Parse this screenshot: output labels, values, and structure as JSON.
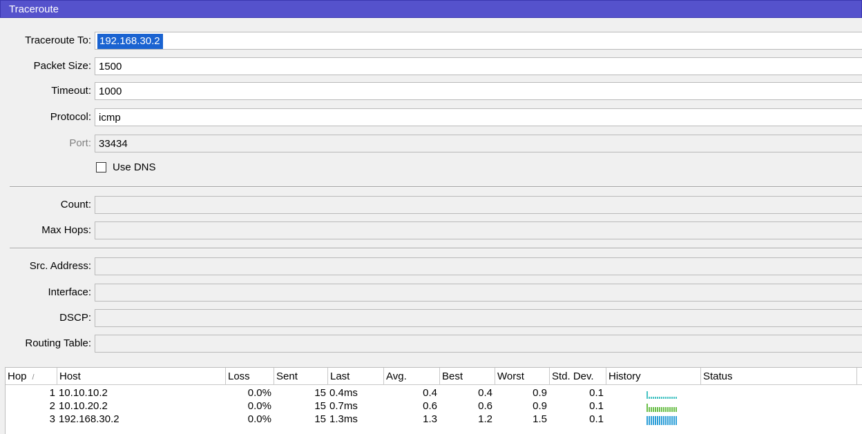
{
  "window": {
    "title": "Traceroute"
  },
  "form": {
    "traceroute_to": {
      "label": "Traceroute To:",
      "value": "192.168.30.2"
    },
    "packet_size": {
      "label": "Packet Size:",
      "value": "1500"
    },
    "timeout": {
      "label": "Timeout:",
      "value": "1000"
    },
    "protocol": {
      "label": "Protocol:",
      "value": "icmp"
    },
    "port": {
      "label": "Port:",
      "value": "33434"
    },
    "use_dns": {
      "label": "Use DNS",
      "checked": false
    },
    "count": {
      "label": "Count:",
      "value": ""
    },
    "max_hops": {
      "label": "Max Hops:",
      "value": ""
    },
    "src_address": {
      "label": "Src. Address:",
      "value": ""
    },
    "interface": {
      "label": "Interface:",
      "value": ""
    },
    "dscp": {
      "label": "DSCP:",
      "value": ""
    },
    "routing_table": {
      "label": "Routing Table:",
      "value": ""
    }
  },
  "table": {
    "columns": [
      "Hop",
      "Host",
      "Loss",
      "Sent",
      "Last",
      "Avg.",
      "Best",
      "Worst",
      "Std. Dev.",
      "History",
      "Status"
    ],
    "sort_indicator": "/",
    "rows": [
      {
        "hop": "1",
        "host": "10.10.10.2",
        "loss": "0.0%",
        "sent": "15",
        "last": "0.4ms",
        "avg": "0.4",
        "best": "0.4",
        "worst": "0.9",
        "std_dev": "0.1",
        "status": "",
        "history_color": "#46c3c3",
        "history_fill": [
          0.85,
          0.2,
          0.2,
          0.2,
          0.2,
          0.2,
          0.2,
          0.2,
          0.2,
          0.2,
          0.2,
          0.2,
          0.2,
          0.2,
          0.2
        ]
      },
      {
        "hop": "2",
        "host": "10.10.20.2",
        "loss": "0.0%",
        "sent": "15",
        "last": "0.7ms",
        "avg": "0.6",
        "best": "0.6",
        "worst": "0.9",
        "std_dev": "0.1",
        "status": "",
        "history_color": "#6cbf4a",
        "history_fill": [
          0.9,
          0.55,
          0.55,
          0.55,
          0.55,
          0.55,
          0.55,
          0.55,
          0.55,
          0.55,
          0.55,
          0.55,
          0.55,
          0.55,
          0.55
        ]
      },
      {
        "hop": "3",
        "host": "192.168.30.2",
        "loss": "0.0%",
        "sent": "15",
        "last": "1.3ms",
        "avg": "1.3",
        "best": "1.2",
        "worst": "1.5",
        "std_dev": "0.1",
        "status": "",
        "history_color": "#2e9fd8",
        "history_fill": [
          1,
          1,
          1,
          1,
          1,
          1,
          1,
          1,
          1,
          1,
          1,
          1,
          1,
          1,
          1
        ]
      }
    ]
  }
}
